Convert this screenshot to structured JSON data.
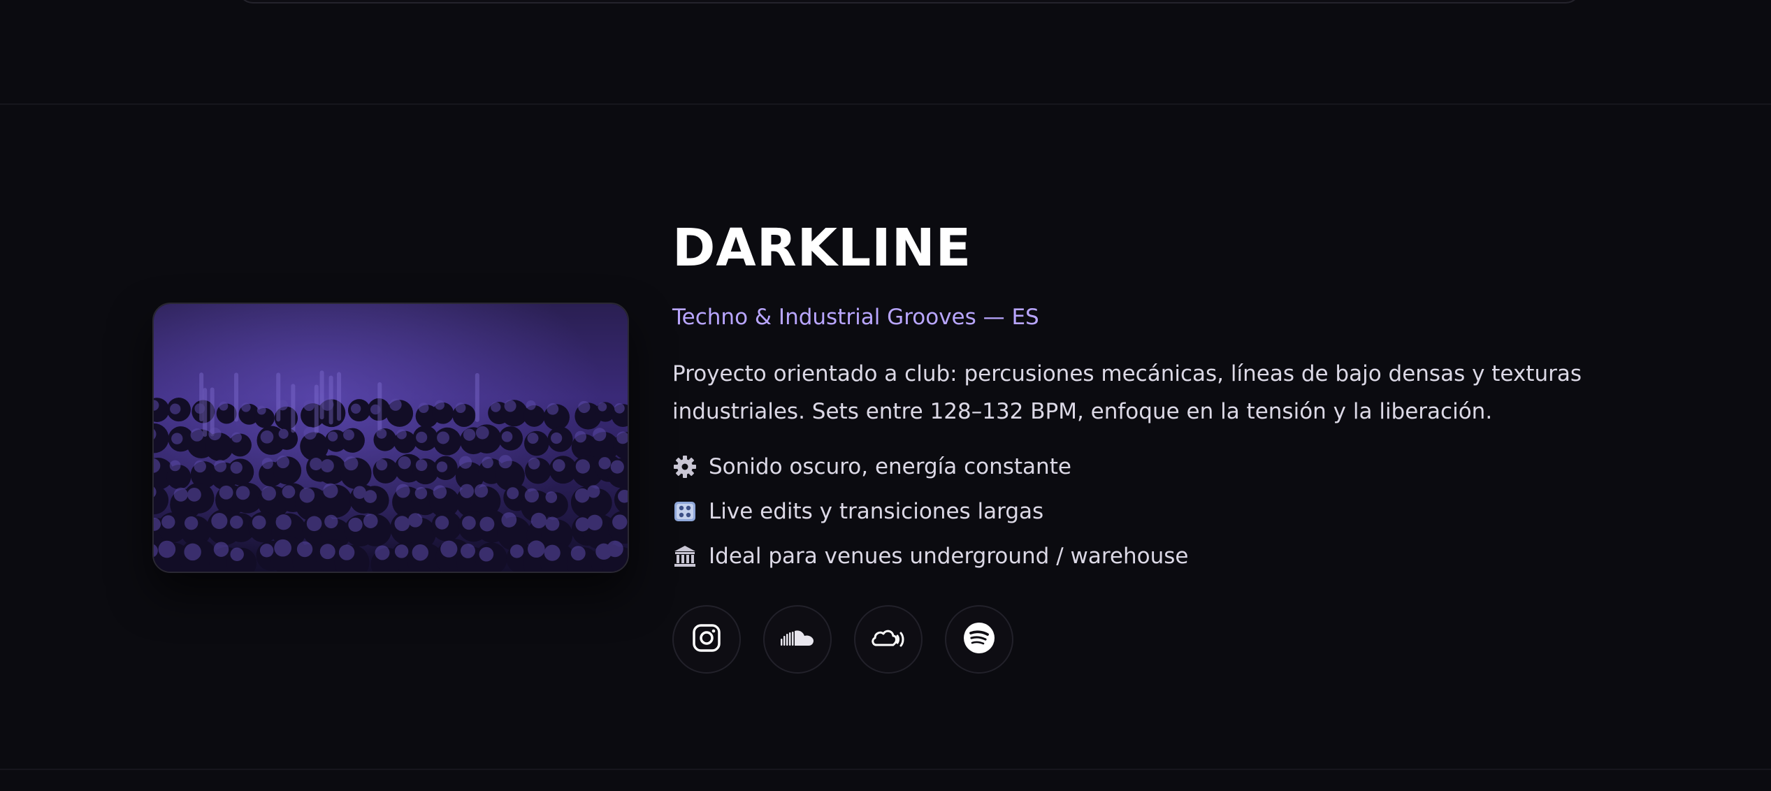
{
  "artist": {
    "name": "DARKLINE",
    "tagline": "Techno & Industrial Grooves — ES",
    "description": "Proyecto orientado a club: percusiones mecánicas, líneas de bajo densas y texturas industriales. Sets entre 128–132 BPM, enfoque en la tensión y la liberación.",
    "image_alt": "crowd-photo"
  },
  "features": [
    {
      "icon": "gear-icon",
      "text": "Sonido oscuro, energía constante"
    },
    {
      "icon": "control-knobs-icon",
      "text": "Live edits y transiciones largas"
    },
    {
      "icon": "classical-building-icon",
      "text": "Ideal para venues underground / warehouse"
    }
  ],
  "socials": [
    {
      "name": "instagram-icon"
    },
    {
      "name": "soundcloud-icon"
    },
    {
      "name": "podcast-cloud-icon"
    },
    {
      "name": "spotify-icon"
    }
  ],
  "colors": {
    "background": "#0b0b10",
    "accent": "#b9a6ff",
    "title": "#ffffff",
    "text": "#dcd9e6"
  }
}
